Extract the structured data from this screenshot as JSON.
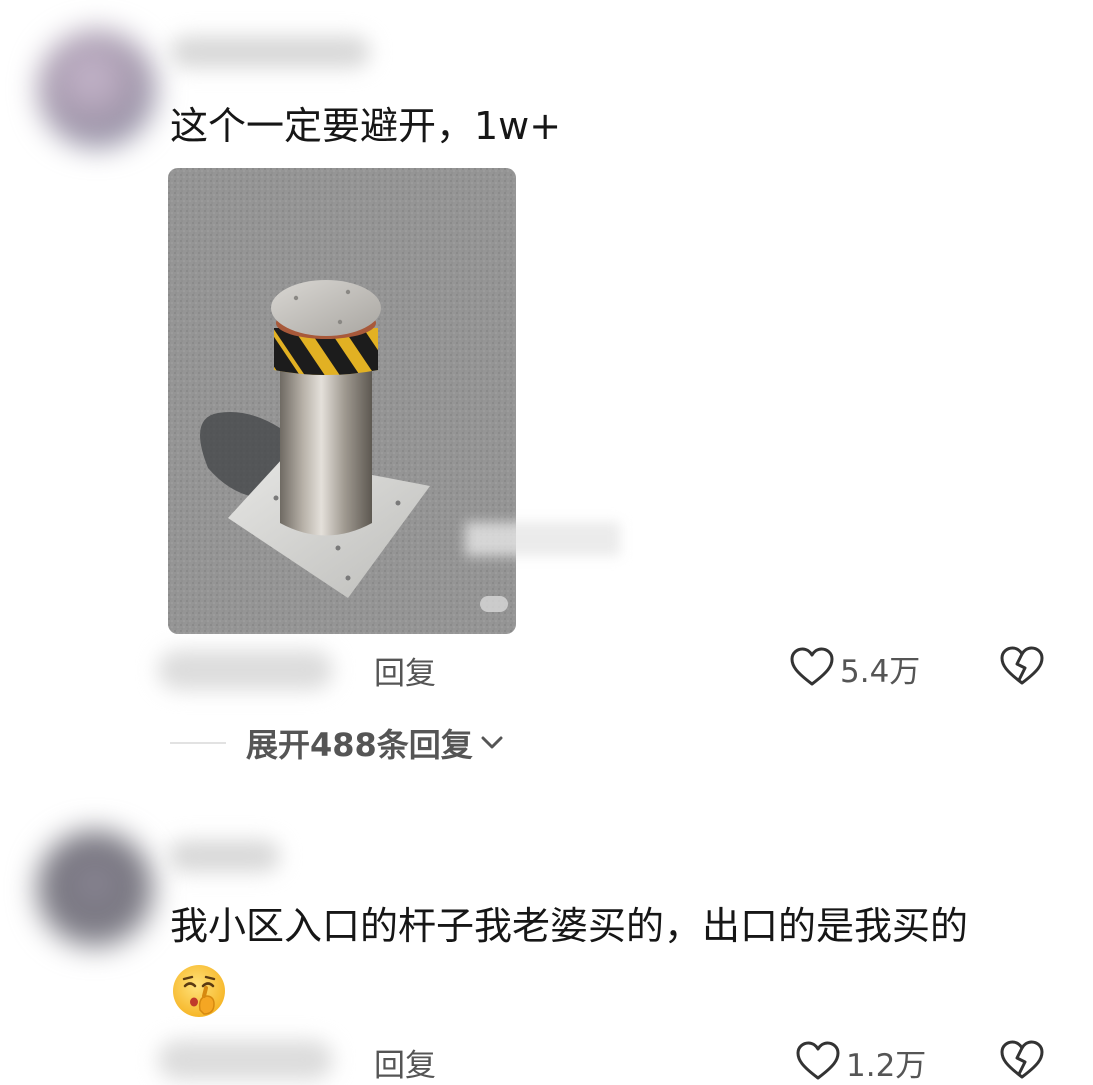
{
  "comments": [
    {
      "text": "这个一定要避开，1w+",
      "reply_label": "回复",
      "like_count": "5.4万",
      "has_image": true,
      "image_icon": "bollard-photo",
      "expand_label": "展开488条回复"
    },
    {
      "text": "我小区入口的杆子我老婆买的，出口的是我买的",
      "emoji_icon": "shushing-face-emoji",
      "reply_label": "回复",
      "like_count": "1.2万"
    }
  ],
  "icons": {
    "like": "heart-outline-icon",
    "dislike": "broken-heart-icon",
    "expand": "chevron-down-icon"
  },
  "colors": {
    "text_primary": "#161616",
    "text_secondary": "#555555",
    "divider": "#e2e2e2"
  }
}
